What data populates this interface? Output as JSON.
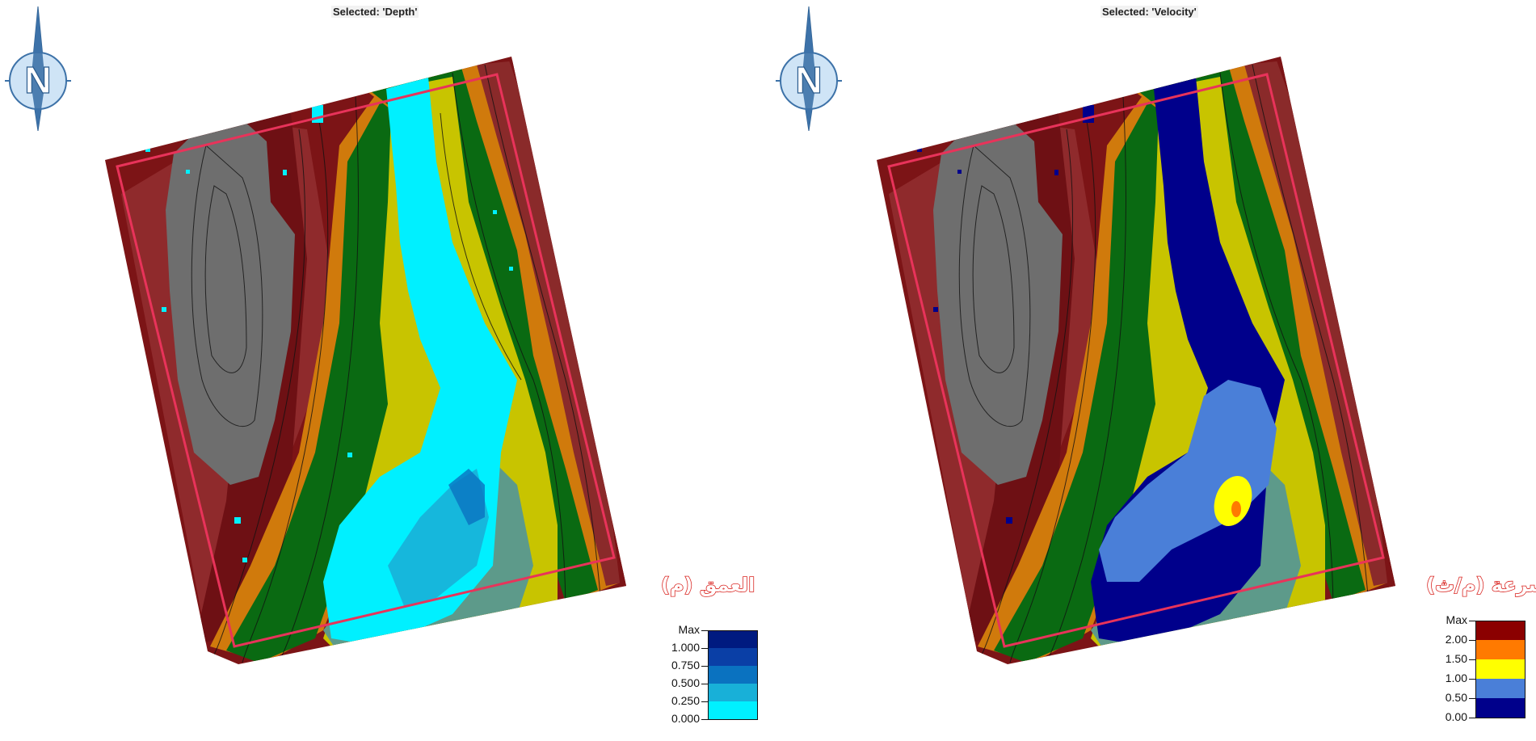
{
  "panels": {
    "depth": {
      "title": "Selected: 'Depth'",
      "compass_letter": "N",
      "legend_title": "العمق (م)",
      "legend": [
        {
          "label": "Max",
          "color": "#001a80"
        },
        {
          "label": "1.000",
          "color": "#0a3fa6"
        },
        {
          "label": "0.750",
          "color": "#0a72c0"
        },
        {
          "label": "0.500",
          "color": "#18b0d8"
        },
        {
          "label": "0.250",
          "color": "#00f0ff"
        },
        {
          "label": "0.000",
          "color": ""
        }
      ]
    },
    "velocity": {
      "title": "Selected: 'Velocity'",
      "compass_letter": "N",
      "legend_title": "السرعة (م/ث)",
      "legend": [
        {
          "label": "Max",
          "color": "#8b0000"
        },
        {
          "label": "2.00",
          "color": "#ff7a00"
        },
        {
          "label": "1.50",
          "color": "#ffff00"
        },
        {
          "label": "1.00",
          "color": "#4a7fd8"
        },
        {
          "label": "0.50",
          "color": "#00008b"
        },
        {
          "label": "0.00",
          "color": ""
        }
      ]
    }
  },
  "colors": {
    "boundary": "#e8335a",
    "terrain_dark": "#7c1416",
    "terrain_mid": "#8f2a2c",
    "terrain_rust": "#8a2a2a",
    "terrain_grey": "#6e6e6e",
    "terrain_orange": "#d07a0c",
    "terrain_green": "#0a6a12",
    "terrain_yellow": "#c8c400",
    "terrain_teal": "#5d9a8a",
    "compass_blue": "#3d72a8"
  }
}
